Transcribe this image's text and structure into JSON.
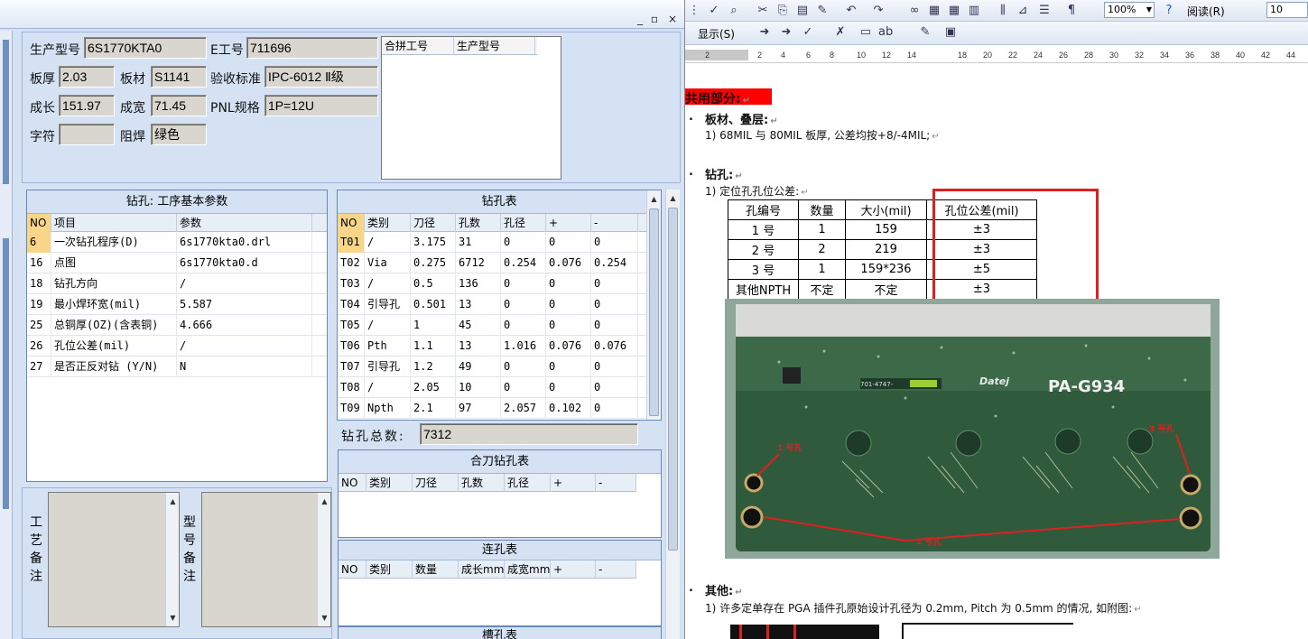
{
  "left": {
    "window_buttons": [
      "_",
      "▫",
      "×"
    ],
    "info": {
      "model_label": "生产型号",
      "model_value": "6S1770KTA0",
      "eno_label": "E工号",
      "eno_value": "711696",
      "thickness_label": "板厚",
      "thickness_value": "2.03",
      "material_label": "板材",
      "material_value": "S1141",
      "standard_label": "验收标准",
      "standard_value": "IPC-6012 Ⅱ级",
      "length_label": "成长",
      "length_value": "151.97",
      "width_label": "成宽",
      "width_value": "71.45",
      "pnl_label": "PNL规格",
      "pnl_value": "1P=12U",
      "char_label": "字符",
      "char_value": "",
      "mask_label": "阻焊",
      "mask_value": "绿色",
      "merge_headers": [
        "合拼工号",
        "生产型号"
      ]
    },
    "params": {
      "title": "钻孔: 工序基本参数",
      "headers": [
        "NO",
        "项目",
        "参数"
      ],
      "rows": [
        [
          "6",
          "一次钻孔程序(D)",
          "6s1770kta0.drl"
        ],
        [
          "16",
          "点图",
          "6s1770kta0.d"
        ],
        [
          "18",
          "钻孔方向",
          "/"
        ],
        [
          "19",
          "最小焊环宽(mil)",
          "5.587"
        ],
        [
          "25",
          "总铜厚(OZ)(含表铜)",
          "4.666"
        ],
        [
          "26",
          "孔位公差(mil)",
          "/"
        ],
        [
          "27",
          "是否正反对钻 (Y/N)",
          "N"
        ]
      ]
    },
    "drill": {
      "title": "钻孔表",
      "headers": [
        "NO",
        "类别",
        "刀径",
        "孔数",
        "孔径",
        "+",
        "-"
      ],
      "rows": [
        [
          "T01",
          "/",
          "3.175",
          "31",
          "0",
          "0",
          "0"
        ],
        [
          "T02",
          "Via",
          "0.275",
          "6712",
          "0.254",
          "0.076",
          "0.254"
        ],
        [
          "T03",
          "/",
          "0.5",
          "136",
          "0",
          "0",
          "0"
        ],
        [
          "T04",
          "引导孔",
          "0.501",
          "13",
          "0",
          "0",
          "0"
        ],
        [
          "T05",
          "/",
          "1",
          "45",
          "0",
          "0",
          "0"
        ],
        [
          "T06",
          "Pth",
          "1.1",
          "13",
          "1.016",
          "0.076",
          "0.076"
        ],
        [
          "T07",
          "引导孔",
          "1.2",
          "49",
          "0",
          "0",
          "0"
        ],
        [
          "T08",
          "/",
          "2.05",
          "10",
          "0",
          "0",
          "0"
        ],
        [
          "T09",
          "Npth",
          "2.1",
          "97",
          "2.057",
          "0.102",
          "0"
        ]
      ],
      "total_label": "钻孔总数:",
      "total_value": "7312"
    },
    "combined": {
      "title": "合刀钻孔表",
      "headers": [
        "NO",
        "类别",
        "刀径",
        "孔数",
        "孔径",
        "+",
        "-"
      ]
    },
    "slot": {
      "title": "连孔表",
      "headers": [
        "NO",
        "类别",
        "数量",
        "成长mm",
        "成宽mm",
        "+",
        "-"
      ]
    },
    "groove": {
      "title": "槽孔表"
    },
    "process_note_label": [
      "工",
      "艺",
      "备",
      "注"
    ],
    "model_note_label": [
      "型",
      "号",
      "备",
      "注"
    ]
  },
  "right": {
    "toolbar1": {
      "zoom": "100%",
      "read_label": "阅读(R)",
      "font_size": "10"
    },
    "toolbar2": {
      "display_label": "显示(S)"
    },
    "ruler_numbers": [
      "2",
      "2",
      "4",
      "6",
      "8",
      "10",
      "12",
      "14",
      "18",
      "20",
      "22",
      "24",
      "26",
      "28",
      "30",
      "32",
      "34",
      "36",
      "38",
      "40",
      "42",
      "44"
    ],
    "doc": {
      "heading": "共用部分:",
      "s1_title": "板材、叠层:",
      "s1_item": "1)  68MIL 与 80MIL 板厚, 公差均按+8/-4MIL;",
      "s2_title": "钻孔:",
      "s2_item": "1)  定位孔孔位公差:",
      "table_headers": [
        "孔编号",
        "数量",
        "大小(mil)",
        "孔位公差(mil)"
      ],
      "table_rows": [
        [
          "1 号",
          "1",
          "159",
          "±3"
        ],
        [
          "2 号",
          "2",
          "219",
          "±3"
        ],
        [
          "3 号",
          "1",
          "159*236",
          "±5"
        ],
        [
          "其他NPTH",
          "不定",
          "不定",
          "±3"
        ]
      ],
      "photo_labels": {
        "hole1": "1 号孔",
        "hole2": "2 号孔",
        "hole3": "3 号孔",
        "board": "PA-G934",
        "brand": "Datej",
        "pn": "701-4747-"
      },
      "s3_title": "其他:",
      "s3_item": "1)  许多定单存在 PGA 插件孔原始设计孔径为 0.2mm, Pitch 为 0.5mm 的情况, 如附图:"
    }
  },
  "colors": {
    "heading_highlight": "#ff0000",
    "callout_box": "#e02020",
    "pcb_green": "#2f5a3c"
  }
}
